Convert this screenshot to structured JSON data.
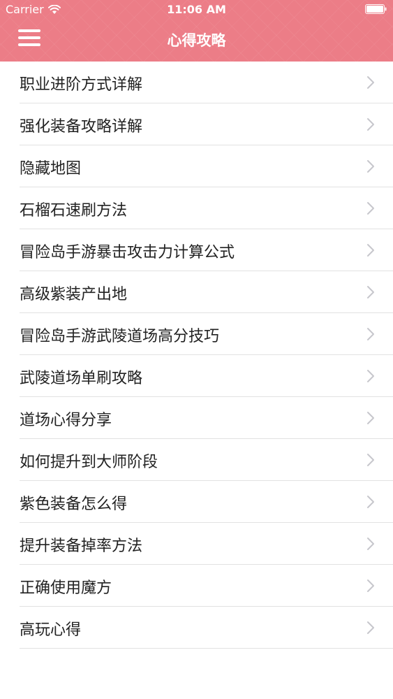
{
  "status_bar": {
    "carrier": "Carrier",
    "time": "11:06 AM"
  },
  "nav": {
    "title": "心得攻略",
    "menu_icon": "hamburger-menu-icon"
  },
  "colors": {
    "header": "#ec7d87",
    "divider": "#e2e2e2",
    "chevron": "#c7c7cc"
  },
  "list": {
    "items": [
      {
        "label": "职业进阶方式详解"
      },
      {
        "label": "强化装备攻略详解"
      },
      {
        "label": "隐藏地图"
      },
      {
        "label": "石榴石速刷方法"
      },
      {
        "label": "冒险岛手游暴击攻击力计算公式"
      },
      {
        "label": "高级紫装产出地"
      },
      {
        "label": "冒险岛手游武陵道场高分技巧"
      },
      {
        "label": "武陵道场单刷攻略"
      },
      {
        "label": "道场心得分享"
      },
      {
        "label": "如何提升到大师阶段"
      },
      {
        "label": "紫色装备怎么得"
      },
      {
        "label": "提升装备掉率方法"
      },
      {
        "label": "正确使用魔方"
      },
      {
        "label": "高玩心得"
      }
    ]
  }
}
